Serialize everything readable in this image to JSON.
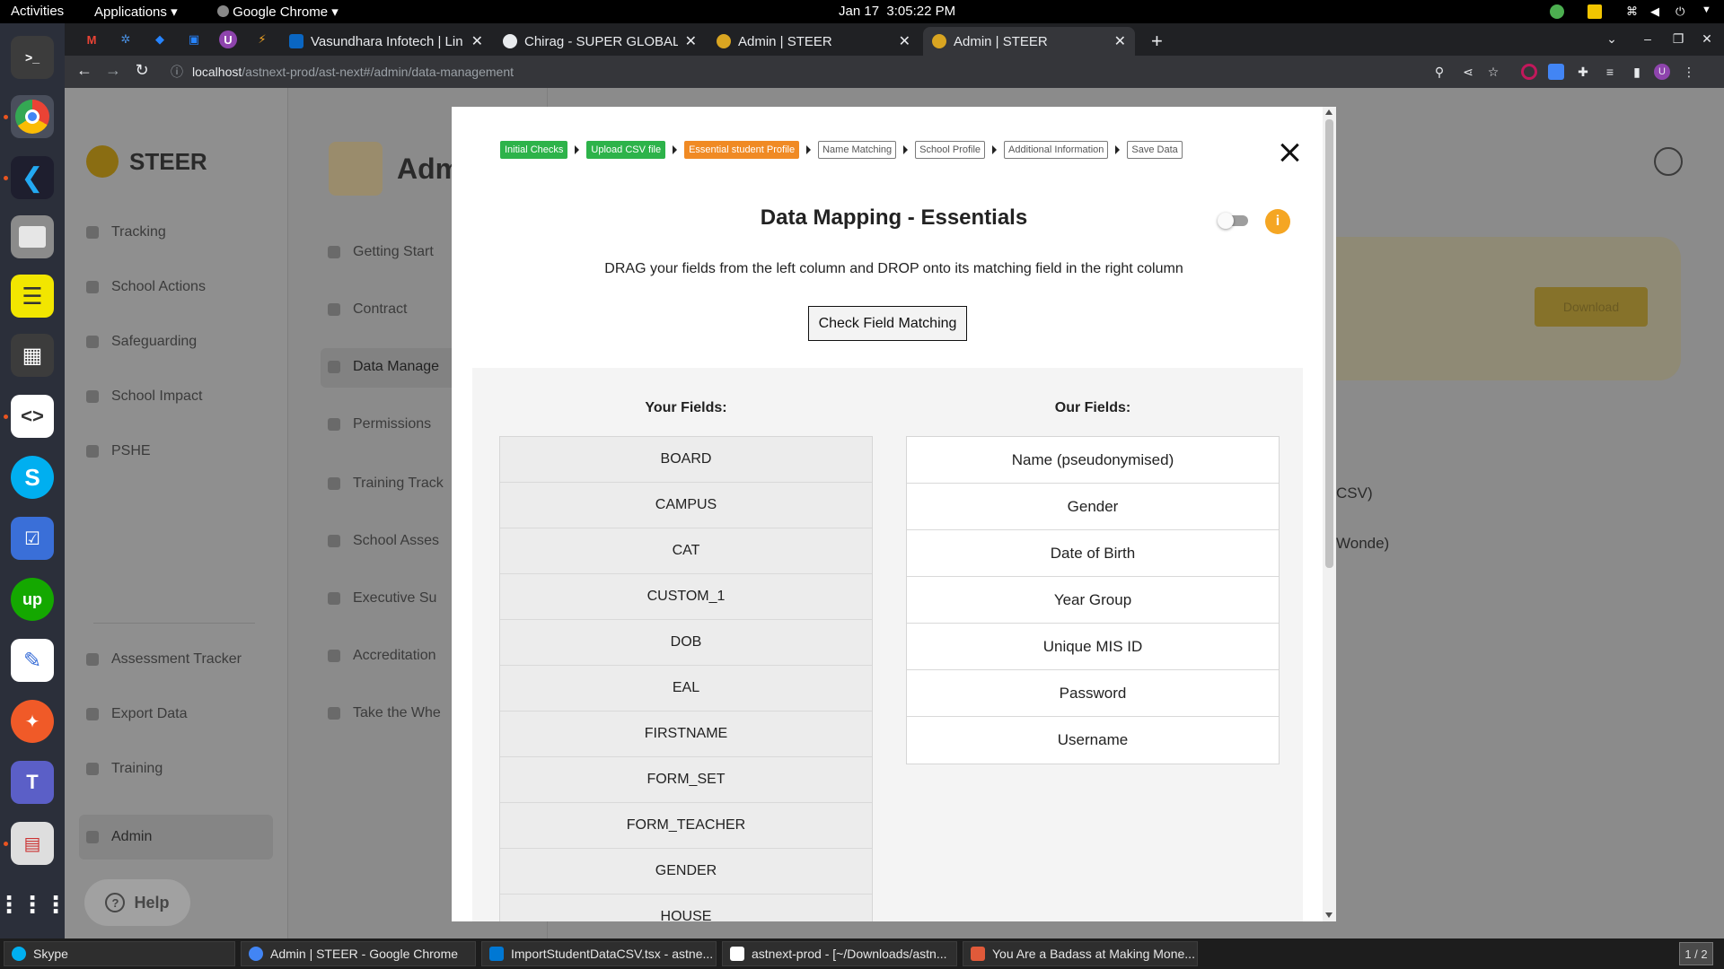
{
  "topbar": {
    "activities": "Activities",
    "applications": "Applications",
    "app_name": "Google Chrome",
    "date": "Jan 17",
    "time": "3:05:22 PM"
  },
  "browser": {
    "tabs": [
      {
        "title": "Vasundhara Infotech | Lin",
        "favicon_color": "#0a66c2"
      },
      {
        "title": "Chirag - SUPER GLOBAL A",
        "favicon_color": "#e8eaed"
      },
      {
        "title": "Admin | STEER",
        "favicon_color": "#d9a521"
      },
      {
        "title": "Admin | STEER",
        "favicon_color": "#d9a521"
      }
    ],
    "url_host": "localhost",
    "url_path": "/astnext-prod/ast-next#/admin/data-management",
    "profile_initial": "U"
  },
  "sidebar": {
    "brand": "STEER",
    "items": [
      {
        "label": "Tracking"
      },
      {
        "label": "School Actions"
      },
      {
        "label": "Safeguarding"
      },
      {
        "label": "School Impact"
      },
      {
        "label": "PSHE"
      }
    ],
    "bottom_items": [
      {
        "label": "Assessment Tracker"
      },
      {
        "label": "Export Data"
      },
      {
        "label": "Training"
      },
      {
        "label": "Admin"
      }
    ],
    "help": "Help"
  },
  "subnav": {
    "title": "Adm",
    "items": [
      {
        "label": "Getting Start"
      },
      {
        "label": "Contract"
      },
      {
        "label": "Data Manage"
      },
      {
        "label": "Permissions"
      },
      {
        "label": "Training Track"
      },
      {
        "label": "School Asses"
      },
      {
        "label": "Executive Su"
      },
      {
        "label": "Accreditation"
      },
      {
        "label": "Take the Whe"
      }
    ]
  },
  "background": {
    "download": "Download",
    "text_csv": "CSV)",
    "text_wonde": "Wonde)"
  },
  "modal": {
    "steps": [
      {
        "label": "Initial Checks",
        "state": "done"
      },
      {
        "label": "Upload CSV file",
        "state": "done"
      },
      {
        "label": "Essential student Profile",
        "state": "current"
      },
      {
        "label": "Name Matching",
        "state": "todo"
      },
      {
        "label": "School Profile",
        "state": "todo"
      },
      {
        "label": "Additional Information",
        "state": "todo"
      },
      {
        "label": "Save Data",
        "state": "todo"
      }
    ],
    "title": "Data Mapping - Essentials",
    "info_glyph": "i",
    "instructions": "DRAG your fields from the left column and DROP onto its matching field in the right column",
    "check_button": "Check Field Matching",
    "your_fields_heading": "Your Fields:",
    "our_fields_heading": "Our Fields:",
    "your_fields": [
      "BOARD",
      "CAMPUS",
      "CAT",
      "CUSTOM_1",
      "DOB",
      "EAL",
      "FIRSTNAME",
      "FORM_SET",
      "FORM_TEACHER",
      "GENDER",
      "HOUSE"
    ],
    "our_fields": [
      "Name (pseudonymised)",
      "Gender",
      "Date of Birth",
      "Year Group",
      "Unique MIS ID",
      "Password",
      "Username"
    ]
  },
  "taskbar": {
    "items": [
      {
        "label": "Skype",
        "color": "#00aff0"
      },
      {
        "label": "Admin | STEER - Google Chrome",
        "color": "#4285f4"
      },
      {
        "label": "ImportStudentDataCSV.tsx - astne...",
        "color": "#0078d4"
      },
      {
        "label": "astnext-prod - [~/Downloads/astn...",
        "color": "#ffffff"
      },
      {
        "label": "You Are a Badass at Making Mone...",
        "color": "#e05a3a"
      }
    ],
    "workspace": "1 / 2"
  }
}
